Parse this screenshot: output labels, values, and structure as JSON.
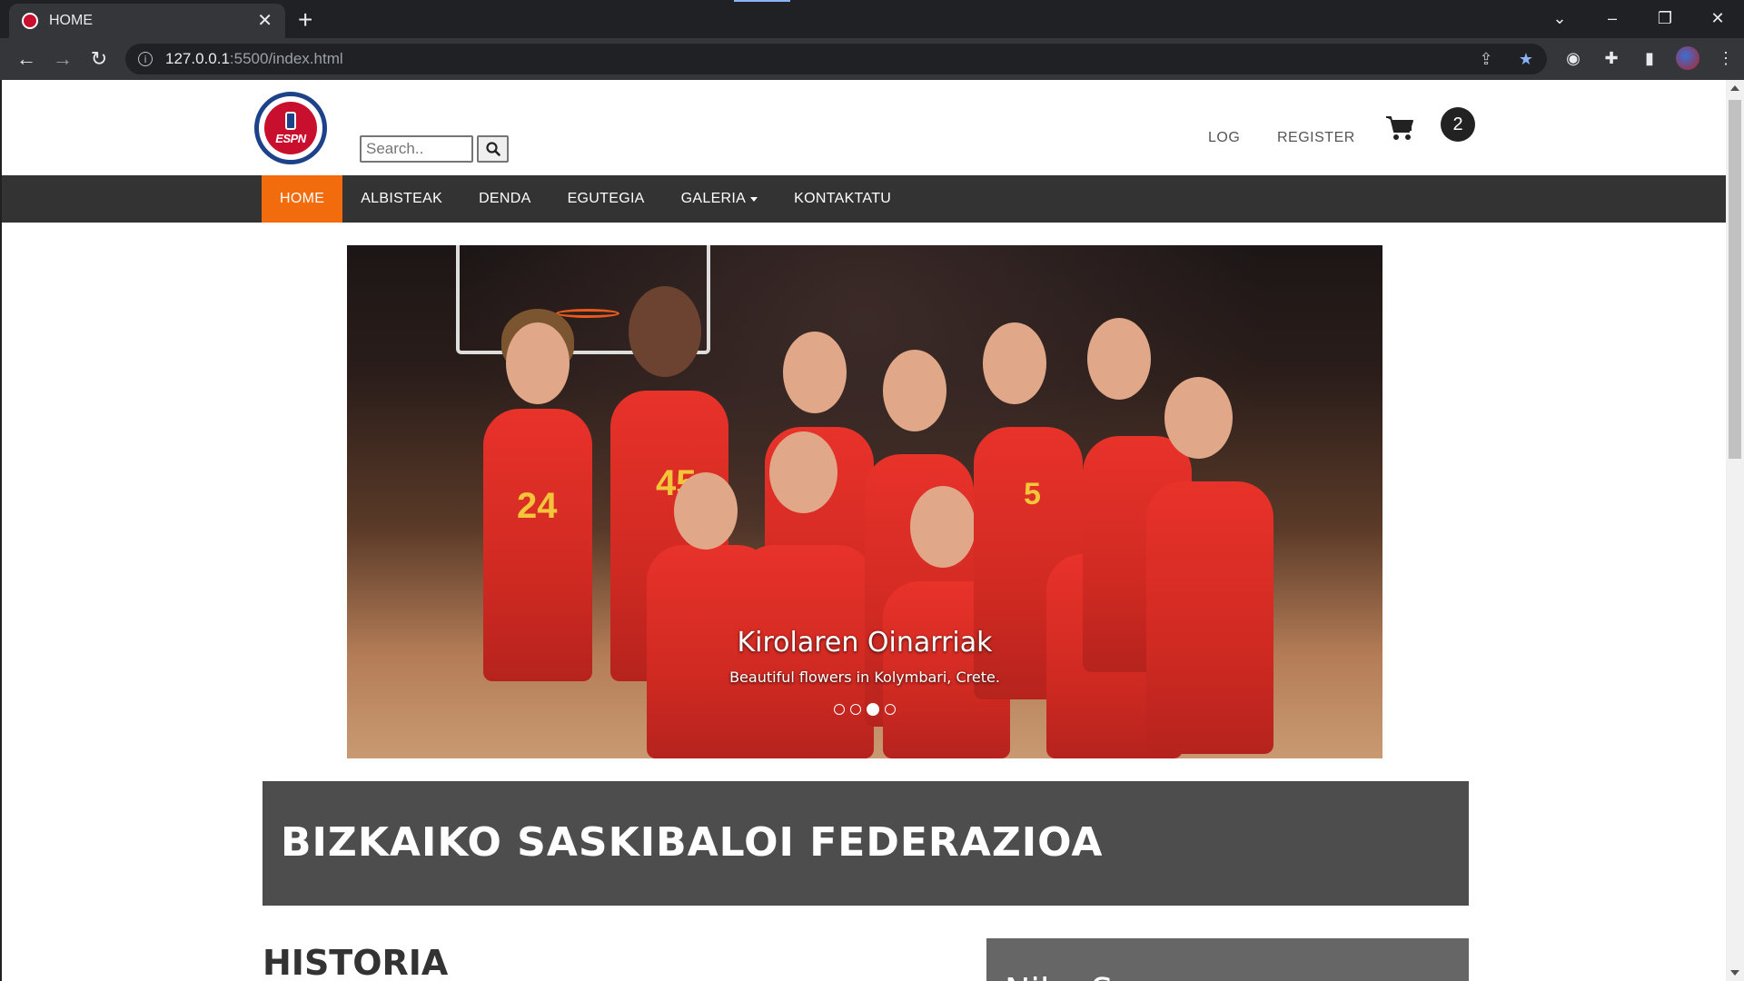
{
  "browser": {
    "tab_title": "HOME",
    "url_host": "127.0.0.1",
    "url_path": ":5500/index.html"
  },
  "header": {
    "logo_text": "ESPN",
    "search_placeholder": "Search..",
    "log_label": "LOG",
    "register_label": "REGISTER",
    "cart_count": "2"
  },
  "nav": {
    "items": [
      {
        "label": "HOME",
        "active": true
      },
      {
        "label": "ALBISTEAK"
      },
      {
        "label": "DENDA"
      },
      {
        "label": "EGUTEGIA"
      },
      {
        "label": "GALERIA",
        "dropdown": true
      },
      {
        "label": "KONTAKTATU"
      }
    ]
  },
  "slideshow": {
    "title": "Kirolaren Oinarriak",
    "caption": "Beautiful flowers in Kolymbari, Crete.",
    "slide_count": 4,
    "active_index": 2,
    "jersey_numbers": [
      "24",
      "45",
      "5"
    ]
  },
  "banner": {
    "title": "BIZKAIKO SASKIBALOI FEDERAZIOA"
  },
  "sections": {
    "historia_title": "HISTORIA",
    "side_title": "Nike Sp..."
  },
  "colors": {
    "nav_bg": "#333333",
    "nav_active": "#f26c0d",
    "banner_bg": "#4d4d4d"
  }
}
